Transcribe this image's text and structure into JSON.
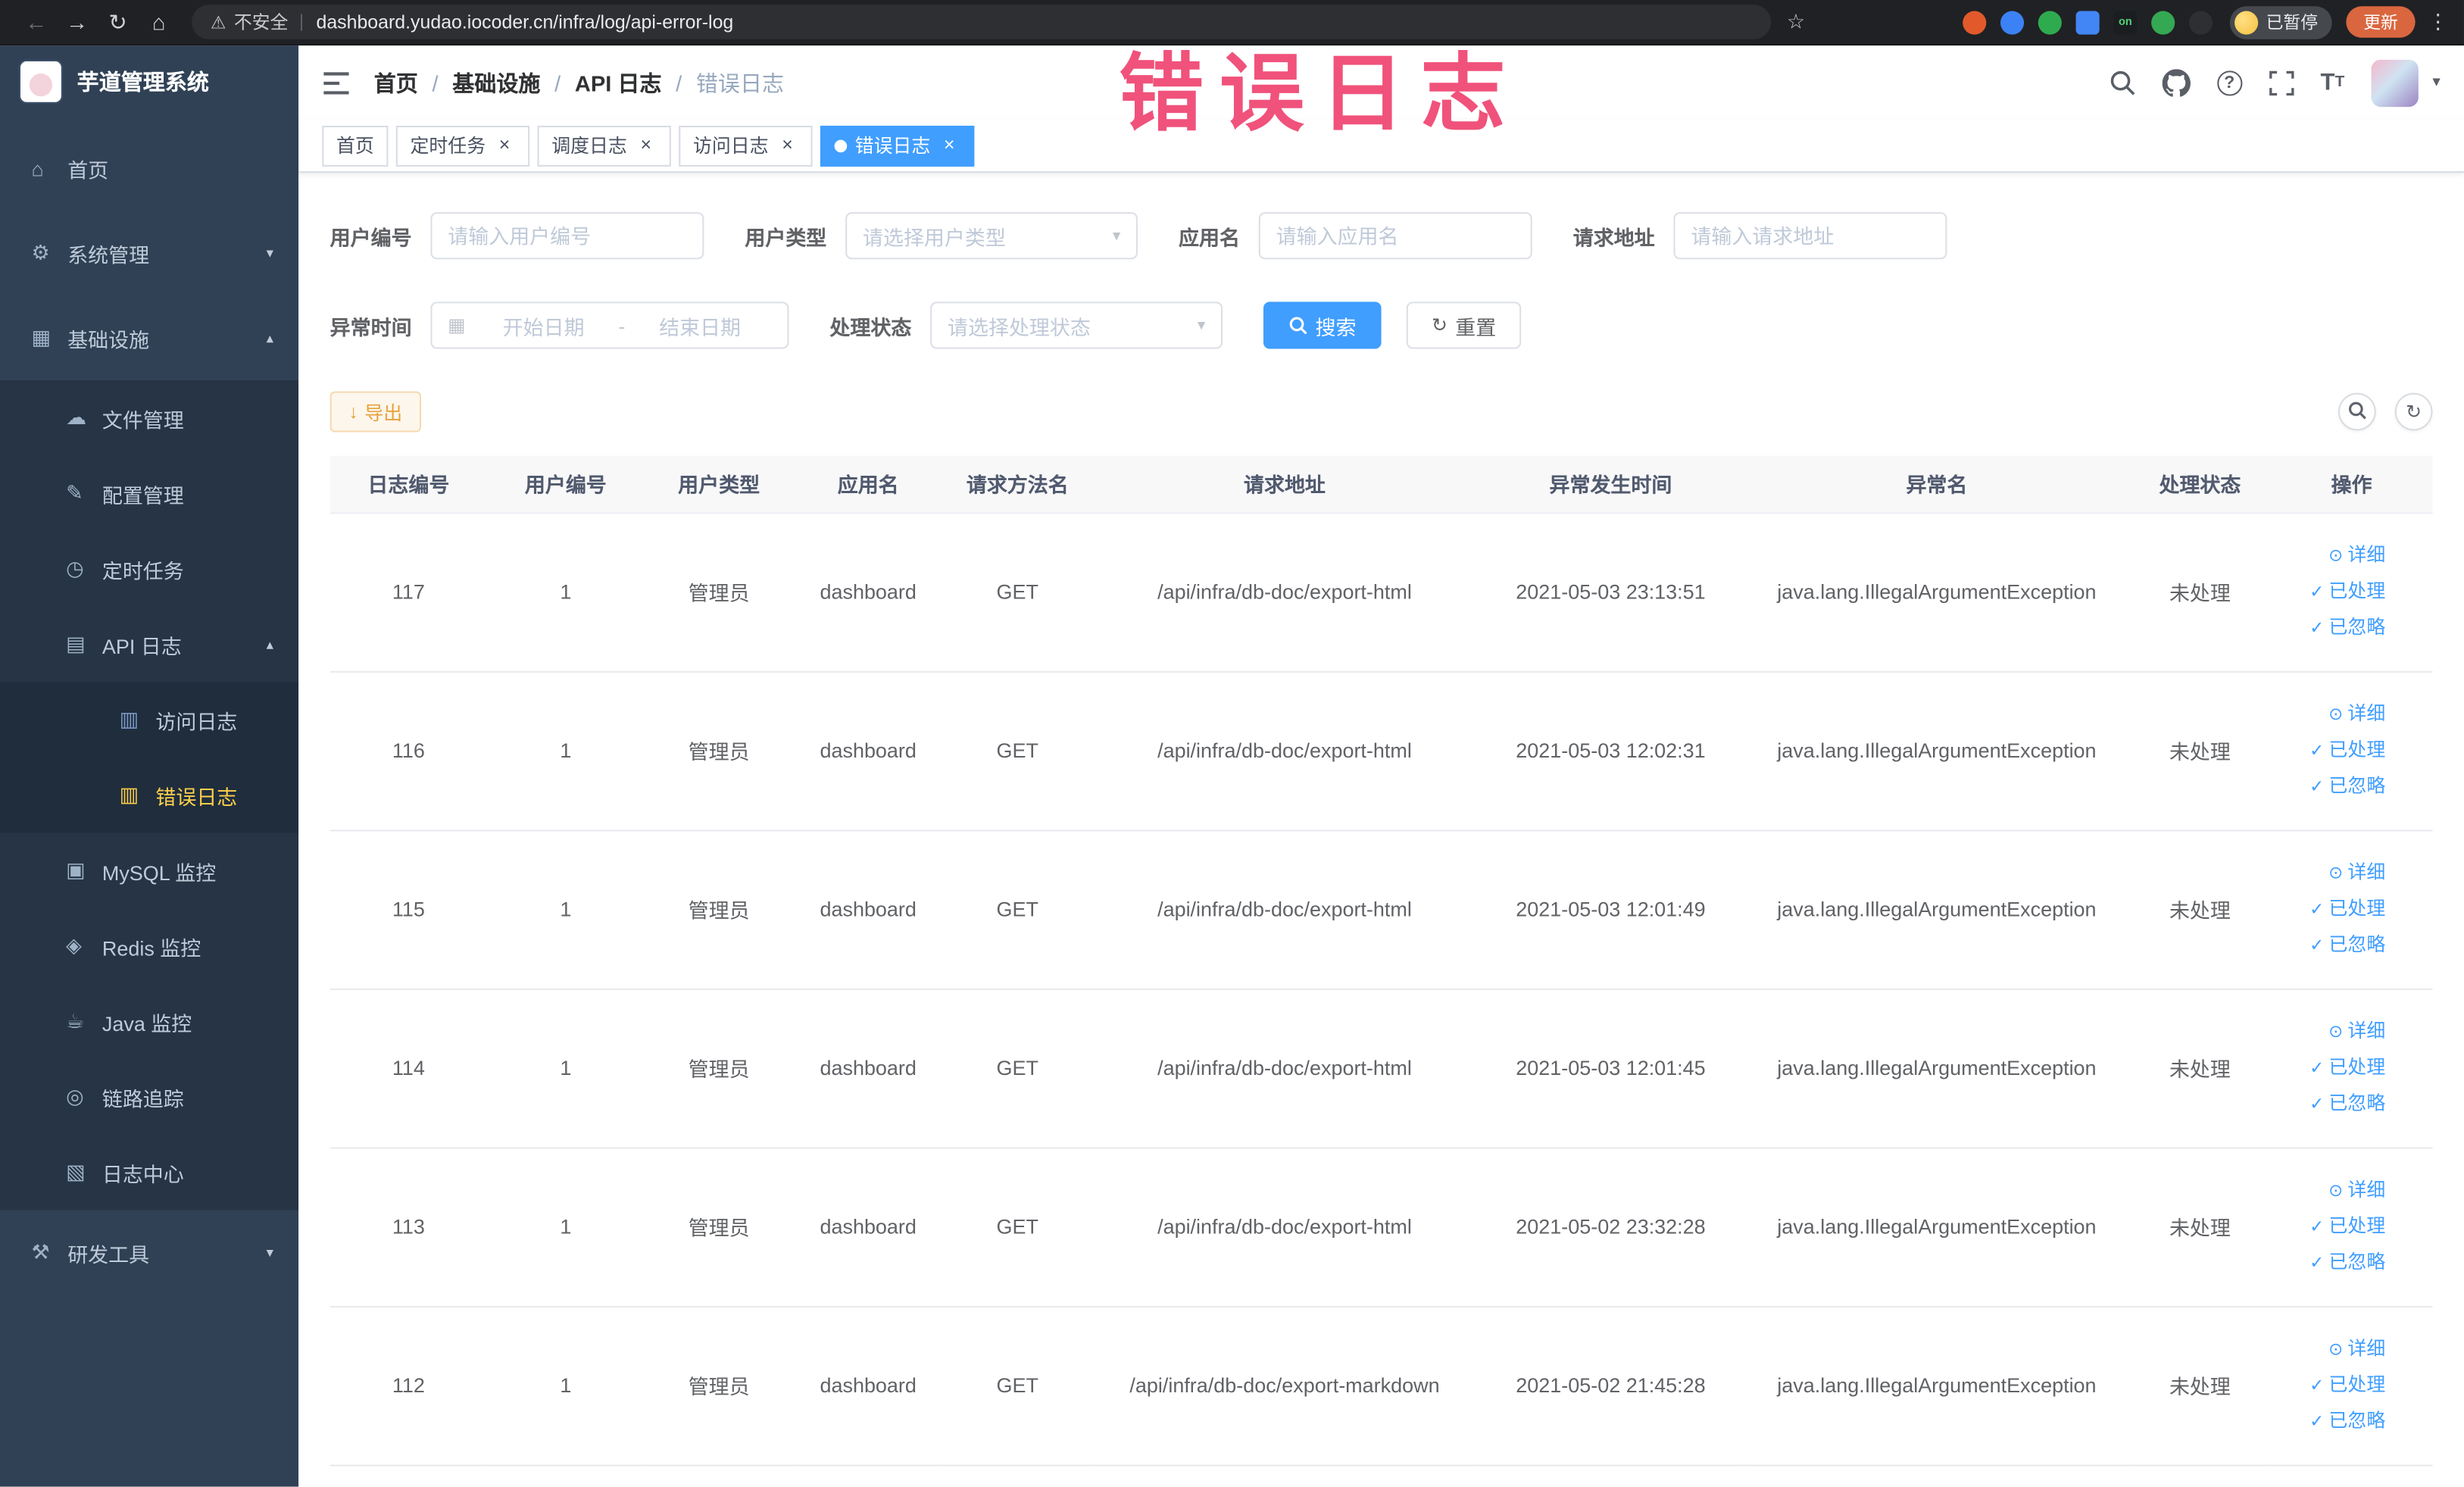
{
  "browser": {
    "security_label": "不安全",
    "url": "dashboard.yudao.iocoder.cn/infra/log/api-error-log",
    "paused_button": "已暂停",
    "update_button": "更新",
    "extensions": [
      {
        "name": "extension-orange-circle",
        "color": "#e25a2b",
        "shape": "circle"
      },
      {
        "name": "extension-blue-circle",
        "color": "#3b82f6",
        "shape": "circle"
      },
      {
        "name": "extension-green-circle",
        "color": "#2fab4f",
        "shape": "circle"
      },
      {
        "name": "extension-blue-grid",
        "color": "#4285f4",
        "shape": "square"
      },
      {
        "name": "extension-on-badge",
        "color": "#1b1e21",
        "shape": "square",
        "label": "on",
        "label_color": "#52d273"
      },
      {
        "name": "extension-green-leaf",
        "color": "#34a853",
        "shape": "circle"
      },
      {
        "name": "extensions-puzzle-icon",
        "color": "#2d2f33",
        "shape": "circle"
      }
    ]
  },
  "annotation": {
    "text": "错误日志"
  },
  "icons": {
    "back": "←",
    "forward": "→",
    "reload": "↻",
    "home": "⌂",
    "warning": "⚠",
    "star": "☆",
    "kebab": "⋮",
    "pipe": "|",
    "close": "×",
    "chevron_down": "▾",
    "chevron_up": "▴",
    "caret_down": "▾",
    "calendar": "▦",
    "download": "↓",
    "refresh": "↻",
    "hamburger": "≡"
  },
  "sidebar": {
    "logo_title": "芋道管理系统",
    "items": [
      {
        "id": "home",
        "label": "首页",
        "icon": "home-icon",
        "glyph": "⌂",
        "level": 1
      },
      {
        "id": "system",
        "label": "系统管理",
        "icon": "gear-icon",
        "glyph": "⚙",
        "level": 1,
        "arrow": "down"
      },
      {
        "id": "infrastructure",
        "label": "基础设施",
        "icon": "infrastructure-icon",
        "glyph": "▦",
        "level": 1,
        "arrow": "up"
      },
      {
        "id": "file-manage",
        "label": "文件管理",
        "icon": "file-cloud-icon",
        "glyph": "☁",
        "level": 2
      },
      {
        "id": "config-manage",
        "label": "配置管理",
        "icon": "config-pencil-icon",
        "glyph": "✎",
        "level": 2
      },
      {
        "id": "scheduled-job",
        "label": "定时任务",
        "icon": "timer-icon",
        "glyph": "◷",
        "level": 2
      },
      {
        "id": "api-log",
        "label": "API 日志",
        "icon": "api-log-icon",
        "glyph": "▤",
        "level": 2,
        "arrow": "up"
      },
      {
        "id": "access-log",
        "label": "访问日志",
        "icon": "access-log-icon",
        "glyph": "▥",
        "level": 3
      },
      {
        "id": "error-log",
        "label": "错误日志",
        "icon": "error-log-icon",
        "glyph": "▥",
        "level": 3,
        "active": true
      },
      {
        "id": "mysql-monitor",
        "label": "MySQL 监控",
        "icon": "mysql-icon",
        "glyph": "▣",
        "level": 2
      },
      {
        "id": "redis-monitor",
        "label": "Redis 监控",
        "icon": "redis-icon",
        "glyph": "◈",
        "level": 2
      },
      {
        "id": "java-monitor",
        "label": "Java 监控",
        "icon": "java-icon",
        "glyph": "☕",
        "level": 2
      },
      {
        "id": "link-trace",
        "label": "链路追踪",
        "icon": "trace-eye-icon",
        "glyph": "◎",
        "level": 2
      },
      {
        "id": "log-center",
        "label": "日志中心",
        "icon": "log-center-icon",
        "glyph": "▧",
        "level": 2
      },
      {
        "id": "dev-tools",
        "label": "研发工具",
        "icon": "tools-icon",
        "glyph": "⚒",
        "level": 1,
        "arrow": "down"
      }
    ]
  },
  "header": {
    "breadcrumb": [
      "首页",
      "基础设施",
      "API 日志",
      "错误日志"
    ]
  },
  "tabs": [
    {
      "label": "首页",
      "closable": false,
      "active": false
    },
    {
      "label": "定时任务",
      "closable": true,
      "active": false
    },
    {
      "label": "调度日志",
      "closable": true,
      "active": false
    },
    {
      "label": "访问日志",
      "closable": true,
      "active": false
    },
    {
      "label": "错误日志",
      "closable": true,
      "active": true
    }
  ],
  "filters": {
    "user_id": {
      "label": "用户编号",
      "placeholder": "请输入用户编号"
    },
    "user_type": {
      "label": "用户类型",
      "placeholder": "请选择用户类型"
    },
    "app_name": {
      "label": "应用名",
      "placeholder": "请输入应用名"
    },
    "request_url": {
      "label": "请求地址",
      "placeholder": "请输入请求地址"
    },
    "exception_time": {
      "label": "异常时间",
      "start_placeholder": "开始日期",
      "separator": "-",
      "end_placeholder": "结束日期"
    },
    "process_status": {
      "label": "处理状态",
      "placeholder": "请选择处理状态"
    },
    "search_label": "搜索",
    "reset_label": "重置"
  },
  "toolbar": {
    "export_label": "导出"
  },
  "table": {
    "columns": [
      "日志编号",
      "用户编号",
      "用户类型",
      "应用名",
      "请求方法名",
      "请求地址",
      "异常发生时间",
      "异常名",
      "处理状态",
      "操作"
    ],
    "rows": [
      [
        "117",
        "1",
        "管理员",
        "dashboard",
        "GET",
        "/api/infra/db-doc/export-html",
        "2021-05-03 23:13:51",
        "java.lang.IllegalArgumentException",
        "未处理"
      ],
      [
        "116",
        "1",
        "管理员",
        "dashboard",
        "GET",
        "/api/infra/db-doc/export-html",
        "2021-05-03 12:02:31",
        "java.lang.IllegalArgumentException",
        "未处理"
      ],
      [
        "115",
        "1",
        "管理员",
        "dashboard",
        "GET",
        "/api/infra/db-doc/export-html",
        "2021-05-03 12:01:49",
        "java.lang.IllegalArgumentException",
        "未处理"
      ],
      [
        "114",
        "1",
        "管理员",
        "dashboard",
        "GET",
        "/api/infra/db-doc/export-html",
        "2021-05-03 12:01:45",
        "java.lang.IllegalArgumentException",
        "未处理"
      ],
      [
        "113",
        "1",
        "管理员",
        "dashboard",
        "GET",
        "/api/infra/db-doc/export-html",
        "2021-05-02 23:32:28",
        "java.lang.IllegalArgumentException",
        "未处理"
      ],
      [
        "112",
        "1",
        "管理员",
        "dashboard",
        "GET",
        "/api/infra/db-doc/export-markdown",
        "2021-05-02 21:45:28",
        "java.lang.IllegalArgumentException",
        "未处理"
      ]
    ],
    "actions": [
      {
        "id": "detail",
        "label": "详细",
        "icon": "eye-icon",
        "glyph": "⊙"
      },
      {
        "id": "processed",
        "label": "已处理",
        "icon": "check-icon",
        "glyph": "✓"
      },
      {
        "id": "ignored",
        "label": "已忽略",
        "icon": "check-icon",
        "glyph": "✓"
      }
    ]
  }
}
